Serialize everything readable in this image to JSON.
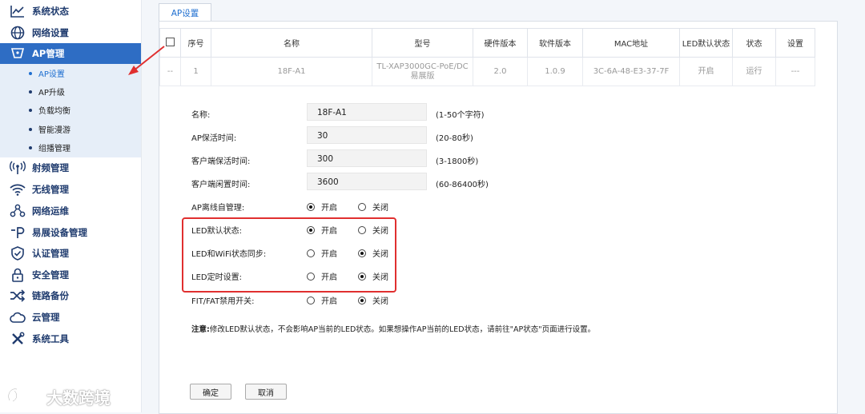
{
  "sidebar": {
    "items": [
      {
        "label": "系统状态",
        "icon": "line-chart-icon"
      },
      {
        "label": "网络设置",
        "icon": "globe-icon"
      },
      {
        "label": "AP管理",
        "icon": "ap-shield-icon",
        "active": true
      },
      {
        "label": "射频管理",
        "icon": "radio-wave-icon"
      },
      {
        "label": "无线管理",
        "icon": "wifi-icon"
      },
      {
        "label": "网络运维",
        "icon": "network-icon"
      },
      {
        "label": "易展设备管理",
        "icon": "link-p-icon"
      },
      {
        "label": "认证管理",
        "icon": "check-shield-icon"
      },
      {
        "label": "安全管理",
        "icon": "lock-icon"
      },
      {
        "label": "链路备份",
        "icon": "shuffle-icon"
      },
      {
        "label": "云管理",
        "icon": "cloud-icon"
      },
      {
        "label": "系统工具",
        "icon": "tools-icon"
      }
    ],
    "subitems": [
      "AP设置",
      "AP升级",
      "负载均衡",
      "智能漫游",
      "组播管理"
    ]
  },
  "tab": {
    "label": "AP设置"
  },
  "table": {
    "headers": [
      "序号",
      "名称",
      "型号",
      "硬件版本",
      "软件版本",
      "MAC地址",
      "LED默认状态",
      "状态",
      "设置"
    ],
    "row": {
      "select": "--",
      "index": "1",
      "name": "18F-A1",
      "model_line1": "TL-XAP3000GC-PoE/DC",
      "model_line2": "易展版",
      "hw": "2.0",
      "sw": "1.0.9",
      "mac": "3C-6A-48-E3-37-7F",
      "led": "开启",
      "status": "运行",
      "settings": "---"
    }
  },
  "form": {
    "name": {
      "label": "名称:",
      "value": "18F-A1",
      "hint": "(1-50个字符)"
    },
    "ap_keepalive": {
      "label": "AP保活时间:",
      "value": "30",
      "hint": "(20-80秒)"
    },
    "client_keepalive": {
      "label": "客户端保活时间:",
      "value": "300",
      "hint": "(3-1800秒)"
    },
    "client_idle": {
      "label": "客户端闲置时间:",
      "value": "3600",
      "hint": "(60-86400秒)"
    },
    "radio_on": "开启",
    "radio_off": "关闭",
    "radios": [
      {
        "label": "AP离线自管理:",
        "selected": "on"
      },
      {
        "label": "LED默认状态:",
        "selected": "on"
      },
      {
        "label": "LED和WiFi状态同步:",
        "selected": "off"
      },
      {
        "label": "LED定时设置:",
        "selected": "off"
      },
      {
        "label": "FIT/FAT禁用开关:",
        "selected": "off"
      }
    ]
  },
  "note": {
    "prefix": "注意:",
    "text": "修改LED默认状态，不会影响AP当前的LED状态。如果想操作AP当前的LED状态，请前往\"AP状态\"页面进行设置。"
  },
  "buttons": {
    "ok": "确定",
    "cancel": "取消"
  },
  "watermark": {
    "text": "大数跨境"
  },
  "colors": {
    "accent": "#2e6dc4",
    "highlight": "#e02f2f",
    "arrow": "#e02f2f"
  }
}
